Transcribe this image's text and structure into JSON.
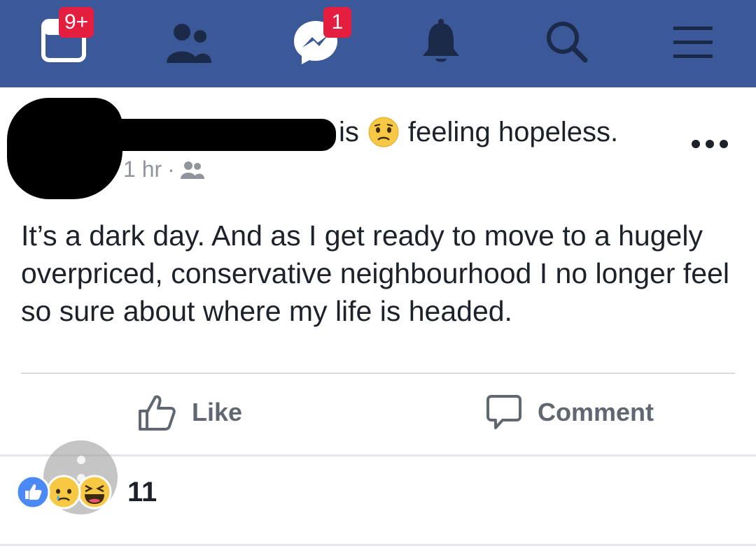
{
  "nav": {
    "news_badge": "9+",
    "messenger_badge": "1",
    "icons": [
      "news-feed-icon",
      "friends-icon",
      "messenger-icon",
      "notifications-icon",
      "search-icon",
      "menu-icon"
    ]
  },
  "post": {
    "verb": "is",
    "feeling_emoji": "worried-face",
    "feeling_text": "feeling hopeless.",
    "time": "1 hr",
    "separator": "·",
    "audience_icon": "friends-audience-icon",
    "body": "It’s a dark day. And as I get ready to move to a hugely overpriced, conservative neighbourhood I no longer feel so sure about where my life is headed."
  },
  "actions": {
    "like_label": "Like",
    "comment_label": "Comment"
  },
  "reactions": {
    "count": "11",
    "types": [
      "like",
      "sad",
      "haha"
    ]
  },
  "colors": {
    "brand": "#3b5998",
    "badge": "#e41e3f",
    "text": "#1d2129",
    "muted": "#90949c",
    "action": "#606770"
  }
}
